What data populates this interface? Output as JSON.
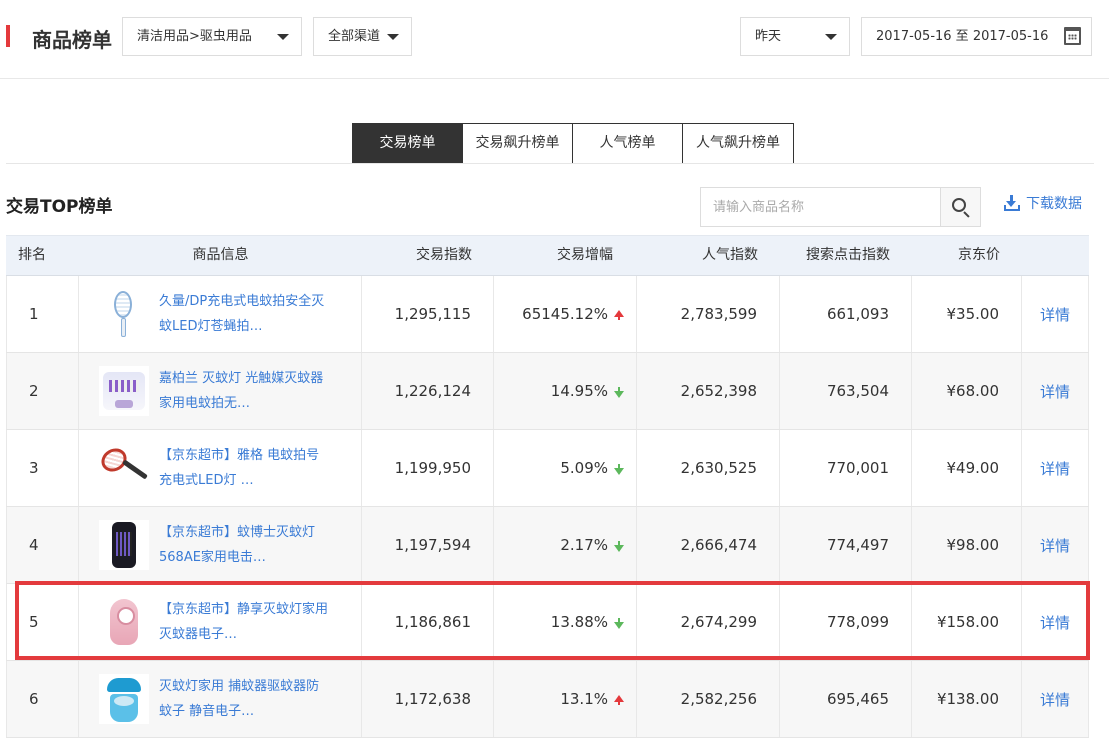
{
  "header": {
    "title": "商品榜单",
    "category_select": "清洁用品>驱虫用品",
    "channel_select": "全部渠道",
    "period_select": "昨天",
    "date_range": "2017-05-16 至 2017-05-16",
    "accent_color": "#e4393c"
  },
  "tabs": [
    {
      "label": "交易榜单",
      "active": true
    },
    {
      "label": "交易飙升榜单",
      "active": false
    },
    {
      "label": "人气榜单",
      "active": false
    },
    {
      "label": "人气飙升榜单",
      "active": false
    }
  ],
  "section": {
    "title": "交易TOP榜单",
    "search_placeholder": "请输入商品名称",
    "download_label": "下载数据"
  },
  "table": {
    "columns": [
      "排名",
      "商品信息",
      "交易指数",
      "交易增幅",
      "人气指数",
      "搜索点击指数",
      "京东价"
    ],
    "rows": [
      {
        "rank": "1",
        "name": "久量/DP充电式电蚊拍安全灭蚊LED灯苍蝇拍…",
        "thumb": "mosquito-racket-icon",
        "trade_index": "1,295,115",
        "growth": "65145.12%",
        "trend": "up",
        "popularity": "2,783,599",
        "search_click": "661,093",
        "price": "¥35.00",
        "detail": "详情"
      },
      {
        "rank": "2",
        "name": "嘉柏兰 灭蚊灯 光触媒灭蚊器家用电蚊拍无…",
        "thumb": "mosquito-lamp-icon",
        "trade_index": "1,226,124",
        "growth": "14.95%",
        "trend": "down",
        "popularity": "2,652,398",
        "search_click": "763,504",
        "price": "¥68.00",
        "detail": "详情"
      },
      {
        "rank": "3",
        "name": "【京东超市】雅格 电蚊拍号充电式LED灯 …",
        "thumb": "red-racket-icon",
        "trade_index": "1,199,950",
        "growth": "5.09%",
        "trend": "down",
        "popularity": "2,630,525",
        "search_click": "770,001",
        "price": "¥49.00",
        "detail": "详情"
      },
      {
        "rank": "4",
        "name": "【京东超市】蚊博士灭蚊灯568AE家用电击…",
        "thumb": "bug-zapper-icon",
        "trade_index": "1,197,594",
        "growth": "2.17%",
        "trend": "down",
        "popularity": "2,666,474",
        "search_click": "774,497",
        "price": "¥98.00",
        "detail": "详情"
      },
      {
        "rank": "5",
        "name": "【京东超市】静享灭蚊灯家用 灭蚊器电子…",
        "thumb": "pink-lamp-icon",
        "trade_index": "1,186,861",
        "growth": "13.88%",
        "trend": "down",
        "popularity": "2,674,299",
        "search_click": "778,099",
        "price": "¥158.00",
        "detail": "详情"
      },
      {
        "rank": "6",
        "name": "灭蚊灯家用 捕蚊器驱蚊器防蚊子 静音电子…",
        "thumb": "blue-lamp-icon",
        "trade_index": "1,172,638",
        "growth": "13.1%",
        "trend": "up",
        "popularity": "2,582,256",
        "search_click": "695,465",
        "price": "¥138.00",
        "detail": "详情"
      }
    ]
  },
  "colors": {
    "link": "#3a7bd5",
    "trend_up": "#e4393c",
    "trend_down": "#5cb85c",
    "highlight_box": "#e33a3d"
  }
}
